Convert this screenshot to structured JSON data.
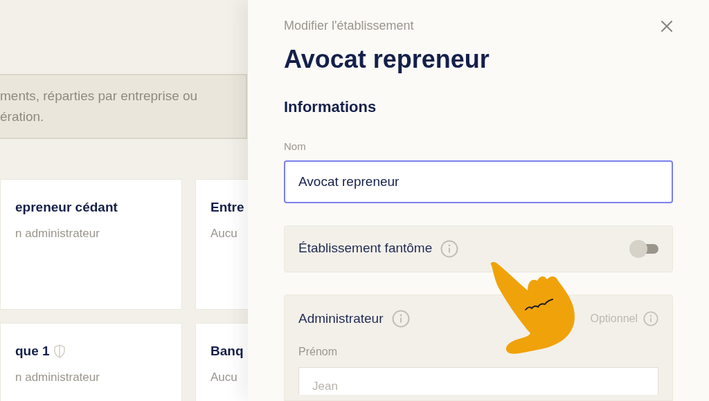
{
  "background": {
    "notice_lines": [
      "ments, réparties par entreprise ou",
      "ération."
    ],
    "cards": [
      {
        "title": "epreneur cédant",
        "subtitle": "n administrateur",
        "shield": false
      },
      {
        "title": "Entre",
        "subtitle": "Aucu",
        "shield": false
      },
      {
        "title": "que 1",
        "subtitle": "n administrateur",
        "shield": true
      },
      {
        "title": "Banq",
        "subtitle": "Aucu",
        "shield": false
      }
    ]
  },
  "panel": {
    "kicker": "Modifier l'établissement",
    "title": "Avocat repreneur",
    "section": "Informations",
    "name_field": {
      "label": "Nom",
      "value": "Avocat repreneur"
    },
    "ghost": {
      "label": "Établissement fantôme",
      "on": false
    },
    "admin": {
      "label": "Administrateur",
      "optional": "Optionnel",
      "first_name": {
        "label": "Prénom",
        "placeholder": "Jean"
      }
    }
  }
}
